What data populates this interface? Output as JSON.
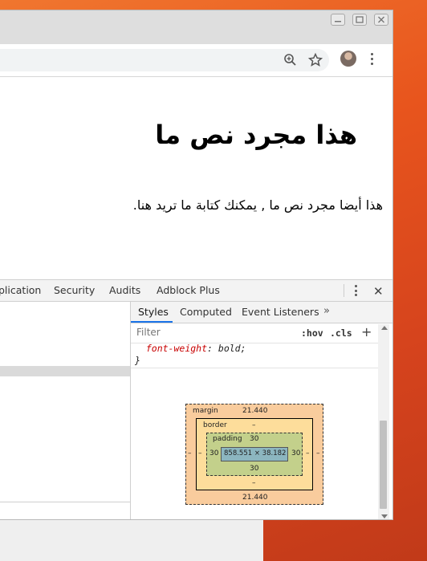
{
  "page": {
    "heading": "هذا مجرد نص ما",
    "paragraph": "هذا أيضا مجرد نص ما , يمكنك كتابة ما تريد هنا."
  },
  "toolbar": {
    "icons": [
      "zoom-icon",
      "bookmark-star-icon",
      "profile-avatar",
      "menu-kebab-icon"
    ]
  },
  "devtools": {
    "tabs": [
      "plication",
      "Security",
      "Audits",
      "Adblock Plus"
    ],
    "sub_tabs": [
      "Styles",
      "Computed",
      "Event Listeners"
    ],
    "active_sub_tab": "Styles",
    "filter_placeholder": "Filter",
    "hov_label": ":hov",
    "cls_label": ".cls",
    "add_rule_label": "+",
    "code": {
      "property": "font-weight",
      "colon": ":",
      "value": "bold;",
      "closing_brace": "}"
    },
    "box_model": {
      "margin_label": "margin",
      "margin_top": "21.440",
      "margin_bottom": "21.440",
      "margin_left": "–",
      "margin_right": "–",
      "border_label": "border",
      "border_top": "–",
      "border_bottom": "–",
      "border_left": "–",
      "border_right": "–",
      "padding_label": "padding",
      "padding_top": "30",
      "padding_bottom": "30",
      "padding_left": "30",
      "padding_right": "30",
      "content_size": "858.551 × 38.182"
    }
  },
  "colors": {
    "desktop_orange": "#e8551d",
    "margin": "#f9cc9d",
    "border": "#fddd9b",
    "padding": "#c3d08b",
    "content": "#8cb6c0",
    "active_tab_underline": "#1a73e8"
  }
}
